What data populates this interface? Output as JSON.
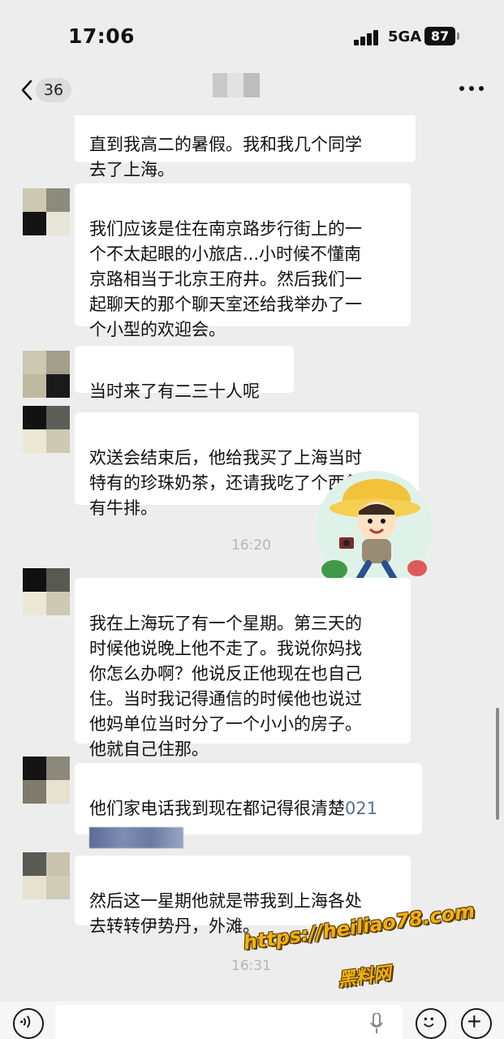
{
  "status": {
    "time": "17:06",
    "network": "5GA",
    "battery": "87"
  },
  "nav": {
    "unread_count": "36"
  },
  "messages": [
    {
      "text": "直到我高二的暑假。我和我几个同学\n去了上海。"
    },
    {
      "text": "我们应该是住在南京路步行街上的一\n个不太起眼的小旅店...小时候不懂南\n京路相当于北京王府井。然后我们一\n起聊天的那个聊天室还给我举办了一\n个小型的欢迎会。"
    },
    {
      "text": "当时来了有二三十人呢"
    },
    {
      "text": "欢送会结束后，他给我买了上海当时\n特有的珍珠奶茶，还请我吃了个西餐。\n有牛排。"
    },
    {
      "text": "我在上海玩了有一个星期。第三天的\n时候他说晚上他不走了。我说你妈找\n你怎么办啊？他说反正他现在也自己\n住。当时我记得通信的时候他也说过\n他妈单位当时分了一个小小的房子。\n他就自己住那。"
    },
    {
      "text": "他们家电话我到现在都记得很清楚",
      "number": "021"
    },
    {
      "text": "然后这一星期他就是带我到上海各处\n去转转伊势丹，外滩。"
    }
  ],
  "timestamps": [
    "16:20",
    "16:31"
  ],
  "watermark": {
    "url": "https://heiliao78.com",
    "name": "黑料网"
  },
  "colors": {
    "background": "#ededed",
    "bubble": "#ffffff",
    "watermark": "#f3b10f"
  }
}
